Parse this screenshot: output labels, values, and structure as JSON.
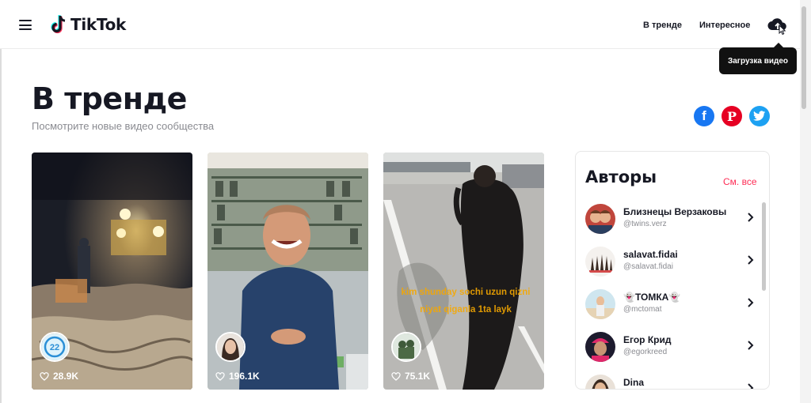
{
  "header": {
    "logo_text": "TikTok",
    "nav": [
      "В тренде",
      "Интересное"
    ],
    "upload_tooltip": "Загрузка видео"
  },
  "page": {
    "title": "В тренде",
    "subtitle": "Посмотрите новые видео сообщества"
  },
  "share": {
    "facebook_glyph": "f",
    "pinterest_glyph": "P"
  },
  "videos": [
    {
      "likes": "28.9K",
      "avatar_icon": "avatar-badge-icon"
    },
    {
      "likes": "196.1K",
      "avatar_icon": "avatar-icon"
    },
    {
      "likes": "75.1K",
      "avatar_icon": "avatar-icon",
      "overlay_text": "kim shunday sochi uzun qizni niyat qiganla 1ta layk"
    }
  ],
  "authors": {
    "title": "Авторы",
    "see_all": "См. все",
    "items": [
      {
        "name": "Близнецы Верзаковы",
        "handle": "@twins.verz"
      },
      {
        "name": "salavat.fidai",
        "handle": "@salavat.fidai"
      },
      {
        "name": "ТОМКА",
        "handle": "@mctomat"
      },
      {
        "name": "Егор Крид",
        "handle": "@egorkreed"
      },
      {
        "name": "Dina",
        "handle": ""
      }
    ]
  },
  "colors": {
    "accent": "#fe2c55",
    "facebook": "#1877f2",
    "pinterest": "#e60023",
    "twitter": "#1da1f2"
  }
}
